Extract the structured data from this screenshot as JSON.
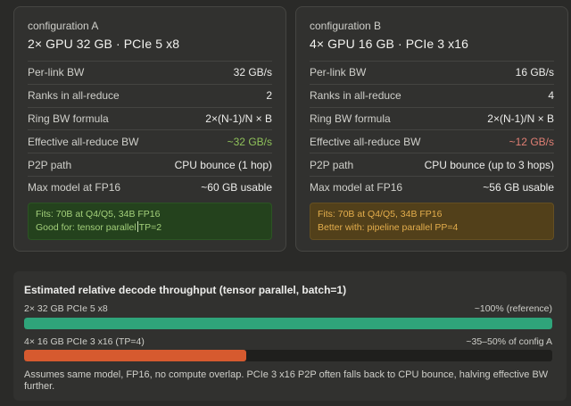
{
  "config_a": {
    "caption": "configuration A",
    "heading": "2× GPU 32 GB · PCIe 5 x8",
    "rows": [
      {
        "label": "Per-link BW",
        "value": "32 GB/s"
      },
      {
        "label": "Ranks in all-reduce",
        "value": "2"
      },
      {
        "label": "Ring BW formula",
        "value": "2×(N-1)/N × B"
      },
      {
        "label": "Effective all-reduce BW",
        "value": "~32 GB/s"
      },
      {
        "label": "P2P path",
        "value": "CPU bounce (1 hop)"
      },
      {
        "label": "Max model at FP16",
        "value": "~60 GB usable"
      }
    ],
    "note_line1": "Fits: 70B at Q4/Q5, 34B FP16",
    "note_line2_a": "Good for: tensor parallel",
    "note_line2_b": "TP=2",
    "colors": {
      "good": "#8fc15a",
      "note_bg": "#24421d",
      "note_text": "#a3d07a"
    }
  },
  "config_b": {
    "caption": "configuration B",
    "heading": "4× GPU 16 GB · PCIe 3 x16",
    "rows": [
      {
        "label": "Per-link BW",
        "value": "16 GB/s"
      },
      {
        "label": "Ranks in all-reduce",
        "value": "4"
      },
      {
        "label": "Ring BW formula",
        "value": "2×(N-1)/N × B"
      },
      {
        "label": "Effective all-reduce BW",
        "value": "~12 GB/s"
      },
      {
        "label": "P2P path",
        "value": "CPU bounce (up to 3 hops)"
      },
      {
        "label": "Max model at FP16",
        "value": "~56 GB usable"
      }
    ],
    "note_line1": "Fits: 70B at Q4/Q5, 34B FP16",
    "note_line2": "Better with: pipeline parallel PP=4",
    "colors": {
      "bad": "#e07f74",
      "note_bg": "#52401a",
      "note_text": "#e3ad4c"
    }
  },
  "throughput": {
    "title": "Estimated relative decode throughput (tensor parallel, batch=1)",
    "bars": [
      {
        "label": "2× 32 GB PCIe 5 x8",
        "right": "~100% (reference)",
        "fraction": 1.0,
        "color": "#2fa47a"
      },
      {
        "label": "4× 16 GB PCIe 3 x16 (TP=4)",
        "right": "~35–50% of config A",
        "fraction": 0.42,
        "color": "#d65a2f"
      }
    ],
    "footnote": "Assumes same model, FP16, no compute overlap. PCIe 3 x16 P2P often falls back to CPU bounce, halving effective BW further."
  }
}
